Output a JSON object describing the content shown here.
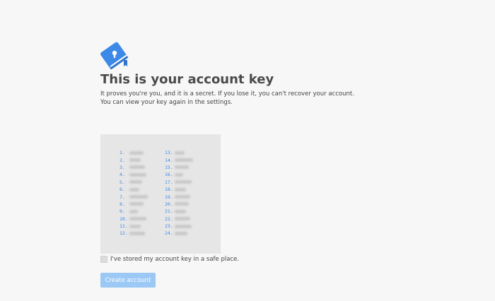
{
  "colors": {
    "background": "#f7f7f7",
    "accent": "#3d89e8",
    "button_disabled": "#9cc8f5",
    "key_box": "#e6e6e6"
  },
  "logo": {
    "icon": "account-key-book-icon"
  },
  "header": {
    "title": "This is your account key",
    "description_line1": "It proves you're you, and it is a secret. If you lose it, you can't recover your account.",
    "description_line2": "You can view your key again in the settings."
  },
  "account_key": {
    "blurred": true,
    "left_numbers": [
      "1.",
      "2.",
      "3.",
      "4.",
      "5.",
      "6.",
      "7.",
      "8.",
      "9.",
      "10.",
      "11.",
      "12."
    ],
    "right_numbers": [
      "13.",
      "14.",
      "15.",
      "16.",
      "17.",
      "18.",
      "19.",
      "20.",
      "21.",
      "22.",
      "23.",
      "24."
    ]
  },
  "confirm": {
    "checked": false,
    "label": "I've stored my account key in a safe place."
  },
  "actions": {
    "create_label": "Create account",
    "create_enabled": false
  }
}
